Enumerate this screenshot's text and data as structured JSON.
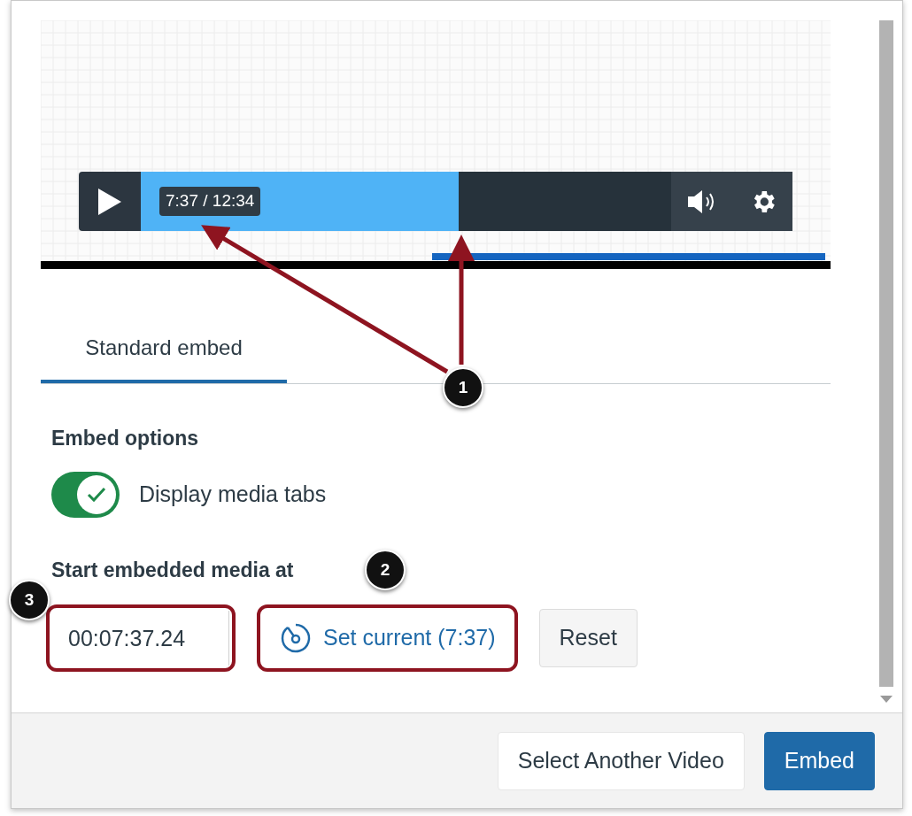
{
  "player": {
    "playing": false,
    "time": "7:37 / 12:34",
    "level": 0.6
  },
  "tabs": [
    {
      "label": "Standard embed",
      "selected": true
    }
  ],
  "embed_options": {
    "heading": "Embed options",
    "toggle": {
      "label": "Display media tabs",
      "on": true
    }
  },
  "start_at": {
    "heading": "Start embedded media at",
    "value": "00:07:37.24",
    "set_current": "Set current (7:37)",
    "reset": "Reset"
  },
  "footer": {
    "buttons": [
      {
        "label": "Select Another Video",
        "kind": "secondary"
      },
      {
        "label": "Embed",
        "kind": "primary"
      }
    ]
  },
  "callouts": [
    {
      "number": "1"
    },
    {
      "number": "2"
    },
    {
      "number": "3"
    }
  ]
}
